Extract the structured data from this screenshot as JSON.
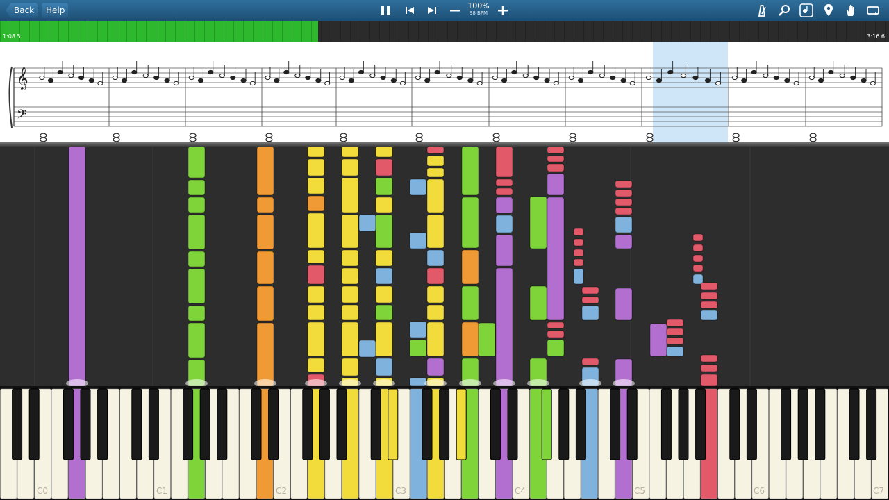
{
  "toolbar": {
    "back_label": "Back",
    "help_label": "Help",
    "tempo_percent": "100%",
    "tempo_bpm": "98 BPM",
    "icons": [
      "pause-icon",
      "skip-back-icon",
      "skip-forward-icon",
      "minus-icon",
      "plus-icon",
      "metronome-icon",
      "search-icon",
      "notation-icon",
      "location-pin-icon",
      "hand-icon",
      "loop-icon"
    ]
  },
  "progress": {
    "elapsed": "1:08.5",
    "total": "3:16.6",
    "played_fraction": 0.358,
    "color": "#2db82d"
  },
  "keyboard": {
    "octave_labels": [
      "C0",
      "C1",
      "C2",
      "C3",
      "C4",
      "C5",
      "C6",
      "C7"
    ],
    "pressed_colors": {
      "purple": "#b36fd0",
      "green": "#7fd43a",
      "orange": "#f09a35",
      "yellow": "#f2dc3c",
      "blue": "#7fb2dd",
      "red": "#e25a6a"
    }
  }
}
